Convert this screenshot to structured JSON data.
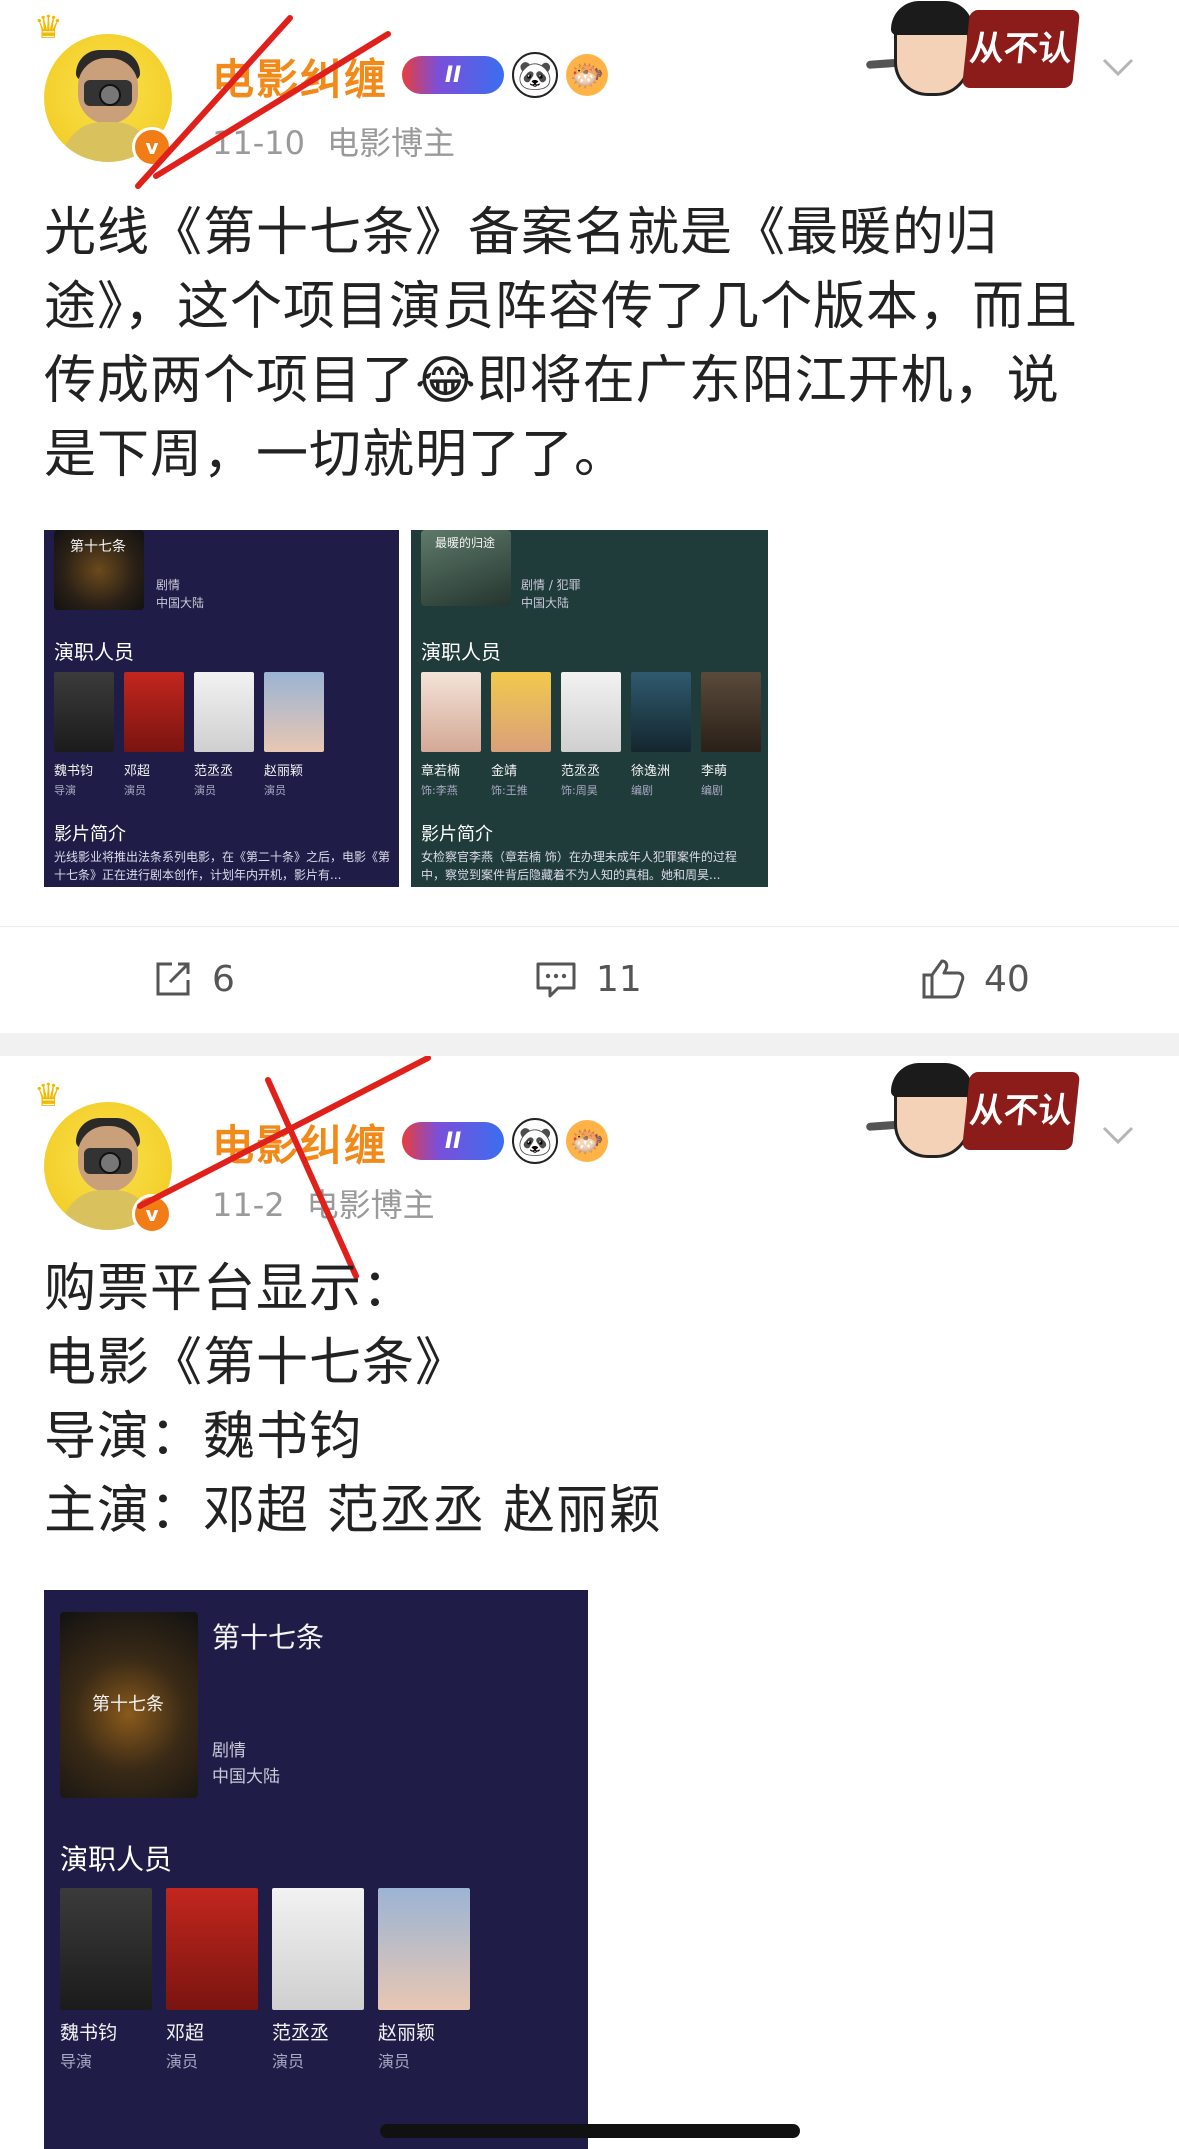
{
  "posts": [
    {
      "user_name": "电影纠缠",
      "level_badge": "II",
      "date": "11-10",
      "user_type": "电影博主",
      "sticker_text": "从不认命",
      "text_lines": [
        "光线《第十七条》备案名就是《最暖的归",
        "途》，这个项目演员阵容传了几个版本，而且",
        "传成两个项目了😂即将在广东阳江开机，说",
        "是下周，一切就明了了。"
      ],
      "images": [
        {
          "title": "第十七条",
          "tags": [
            "剧情",
            "中国大陆"
          ],
          "cast_heading": "演职人员",
          "cast": [
            {
              "name": "魏书钧",
              "role": "导演"
            },
            {
              "name": "邓超",
              "role": "演员"
            },
            {
              "name": "范丞丞",
              "role": "演员"
            },
            {
              "name": "赵丽颖",
              "role": "演员"
            }
          ],
          "intro_heading": "影片简介",
          "intro_text": "光线影业将推出法条系列电影，在《第二十条》之后，电影《第十七条》正在进行剧本创作，计划年内开机，影片有..."
        },
        {
          "title": "最暖的归途",
          "tags": [
            "剧情 / 犯罪",
            "中国大陆"
          ],
          "cast_heading": "演职人员",
          "cast": [
            {
              "name": "章若楠",
              "role": "饰:李燕"
            },
            {
              "name": "金靖",
              "role": "饰:王推"
            },
            {
              "name": "范丞丞",
              "role": "饰:周昊"
            },
            {
              "name": "徐逸洲",
              "role": "编剧"
            },
            {
              "name": "李萌",
              "role": "编剧"
            }
          ],
          "intro_heading": "影片简介",
          "intro_text": "女检察官李燕（章若楠 饰）在办理未成年人犯罪案件的过程中，察觉到案件背后隐藏着不为人知的真相。她和周昊..."
        }
      ],
      "actions": {
        "repost": "6",
        "comment": "11",
        "like": "40"
      }
    },
    {
      "user_name": "电影纠缠",
      "level_badge": "II",
      "date": "11-2",
      "user_type": "电影博主",
      "sticker_text": "从不认命",
      "text_lines": [
        "购票平台显示：",
        "电影《第十七条》",
        "导演：魏书钧",
        "主演：邓超 范丞丞 赵丽颖"
      ],
      "images": [
        {
          "title": "第十七条",
          "poster_text": "第十七条",
          "tags": [
            "剧情",
            "中国大陆"
          ],
          "cast_heading": "演职人员",
          "cast": [
            {
              "name": "魏书钧",
              "role": "导演"
            },
            {
              "name": "邓超",
              "role": "演员"
            },
            {
              "name": "范丞丞",
              "role": "演员"
            },
            {
              "name": "赵丽颖",
              "role": "演员"
            }
          ]
        }
      ]
    }
  ],
  "colors": {
    "username": "#f28a1a",
    "meta": "#9a9a9a",
    "cross": "#e0201a",
    "card_bg_1": "#1f1d47",
    "card_bg_2": "#1f3b3a"
  }
}
